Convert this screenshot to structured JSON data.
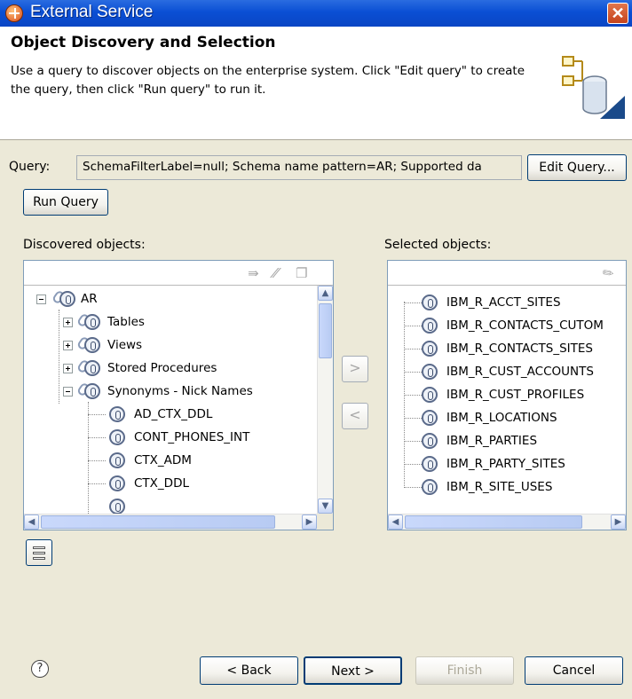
{
  "window": {
    "title": "External Service",
    "close_glyph": "✕"
  },
  "banner": {
    "title": "Object Discovery and Selection",
    "description": "Use a query to discover objects on the enterprise system.  Click \"Edit query\" to create the query, then click \"Run query\" to run it.",
    "icon": "database-wizard-icon"
  },
  "query": {
    "label": "Query:",
    "value": "SchemaFilterLabel=null; Schema name pattern=AR; Supported da",
    "edit_button": "Edit Query...",
    "run_button": "Run Query"
  },
  "discovered": {
    "label": "Discovered objects:",
    "toolbar_icons": [
      "filter-icon",
      "edit-icon",
      "book-icon"
    ],
    "tree": [
      {
        "label": "AR",
        "expanded": true
      },
      {
        "label": "Tables",
        "expanded": false
      },
      {
        "label": "Views",
        "expanded": false
      },
      {
        "label": "Stored Procedures",
        "expanded": false
      },
      {
        "label": "Synonyms - Nick Names",
        "expanded": true
      },
      {
        "label": "AD_CTX_DDL"
      },
      {
        "label": "CONT_PHONES_INT"
      },
      {
        "label": "CTX_ADM"
      },
      {
        "label": "CTX_DDL"
      }
    ]
  },
  "selected": {
    "label": "Selected objects:",
    "toolbar_icons": [
      "pencil-icon"
    ],
    "items": [
      "IBM_R_ACCT_SITES",
      "IBM_R_CONTACTS_CUTOM",
      "IBM_R_CONTACTS_SITES",
      "IBM_R_CUST_ACCOUNTS",
      "IBM_R_CUST_PROFILES",
      "IBM_R_LOCATIONS",
      "IBM_R_PARTIES",
      "IBM_R_PARTY_SITES",
      "IBM_R_SITE_USES"
    ]
  },
  "transfer": {
    "add_glyph": ">",
    "remove_glyph": "<"
  },
  "footer": {
    "help_glyph": "?",
    "back": "< Back",
    "next": "Next >",
    "finish": "Finish",
    "cancel": "Cancel"
  },
  "colors": {
    "title_bar": "#0a4fd4",
    "dialog_bg": "#ece9d8",
    "button_border": "#003c74"
  }
}
